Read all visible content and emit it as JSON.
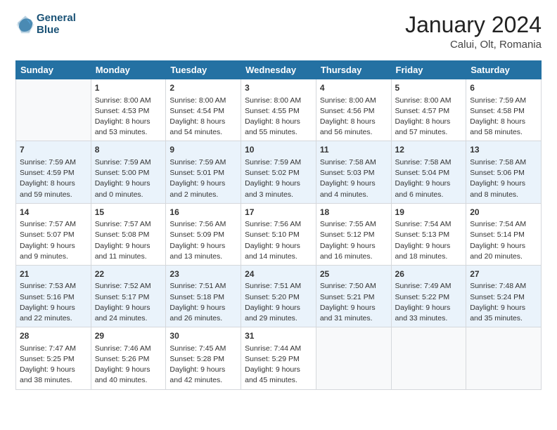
{
  "header": {
    "logo_line1": "General",
    "logo_line2": "Blue",
    "month_title": "January 2024",
    "location": "Calui, Olt, Romania"
  },
  "columns": [
    "Sunday",
    "Monday",
    "Tuesday",
    "Wednesday",
    "Thursday",
    "Friday",
    "Saturday"
  ],
  "weeks": [
    [
      {
        "day": "",
        "info": ""
      },
      {
        "day": "1",
        "info": "Sunrise: 8:00 AM\nSunset: 4:53 PM\nDaylight: 8 hours\nand 53 minutes."
      },
      {
        "day": "2",
        "info": "Sunrise: 8:00 AM\nSunset: 4:54 PM\nDaylight: 8 hours\nand 54 minutes."
      },
      {
        "day": "3",
        "info": "Sunrise: 8:00 AM\nSunset: 4:55 PM\nDaylight: 8 hours\nand 55 minutes."
      },
      {
        "day": "4",
        "info": "Sunrise: 8:00 AM\nSunset: 4:56 PM\nDaylight: 8 hours\nand 56 minutes."
      },
      {
        "day": "5",
        "info": "Sunrise: 8:00 AM\nSunset: 4:57 PM\nDaylight: 8 hours\nand 57 minutes."
      },
      {
        "day": "6",
        "info": "Sunrise: 7:59 AM\nSunset: 4:58 PM\nDaylight: 8 hours\nand 58 minutes."
      }
    ],
    [
      {
        "day": "7",
        "info": "Sunrise: 7:59 AM\nSunset: 4:59 PM\nDaylight: 8 hours\nand 59 minutes."
      },
      {
        "day": "8",
        "info": "Sunrise: 7:59 AM\nSunset: 5:00 PM\nDaylight: 9 hours\nand 0 minutes."
      },
      {
        "day": "9",
        "info": "Sunrise: 7:59 AM\nSunset: 5:01 PM\nDaylight: 9 hours\nand 2 minutes."
      },
      {
        "day": "10",
        "info": "Sunrise: 7:59 AM\nSunset: 5:02 PM\nDaylight: 9 hours\nand 3 minutes."
      },
      {
        "day": "11",
        "info": "Sunrise: 7:58 AM\nSunset: 5:03 PM\nDaylight: 9 hours\nand 4 minutes."
      },
      {
        "day": "12",
        "info": "Sunrise: 7:58 AM\nSunset: 5:04 PM\nDaylight: 9 hours\nand 6 minutes."
      },
      {
        "day": "13",
        "info": "Sunrise: 7:58 AM\nSunset: 5:06 PM\nDaylight: 9 hours\nand 8 minutes."
      }
    ],
    [
      {
        "day": "14",
        "info": "Sunrise: 7:57 AM\nSunset: 5:07 PM\nDaylight: 9 hours\nand 9 minutes."
      },
      {
        "day": "15",
        "info": "Sunrise: 7:57 AM\nSunset: 5:08 PM\nDaylight: 9 hours\nand 11 minutes."
      },
      {
        "day": "16",
        "info": "Sunrise: 7:56 AM\nSunset: 5:09 PM\nDaylight: 9 hours\nand 13 minutes."
      },
      {
        "day": "17",
        "info": "Sunrise: 7:56 AM\nSunset: 5:10 PM\nDaylight: 9 hours\nand 14 minutes."
      },
      {
        "day": "18",
        "info": "Sunrise: 7:55 AM\nSunset: 5:12 PM\nDaylight: 9 hours\nand 16 minutes."
      },
      {
        "day": "19",
        "info": "Sunrise: 7:54 AM\nSunset: 5:13 PM\nDaylight: 9 hours\nand 18 minutes."
      },
      {
        "day": "20",
        "info": "Sunrise: 7:54 AM\nSunset: 5:14 PM\nDaylight: 9 hours\nand 20 minutes."
      }
    ],
    [
      {
        "day": "21",
        "info": "Sunrise: 7:53 AM\nSunset: 5:16 PM\nDaylight: 9 hours\nand 22 minutes."
      },
      {
        "day": "22",
        "info": "Sunrise: 7:52 AM\nSunset: 5:17 PM\nDaylight: 9 hours\nand 24 minutes."
      },
      {
        "day": "23",
        "info": "Sunrise: 7:51 AM\nSunset: 5:18 PM\nDaylight: 9 hours\nand 26 minutes."
      },
      {
        "day": "24",
        "info": "Sunrise: 7:51 AM\nSunset: 5:20 PM\nDaylight: 9 hours\nand 29 minutes."
      },
      {
        "day": "25",
        "info": "Sunrise: 7:50 AM\nSunset: 5:21 PM\nDaylight: 9 hours\nand 31 minutes."
      },
      {
        "day": "26",
        "info": "Sunrise: 7:49 AM\nSunset: 5:22 PM\nDaylight: 9 hours\nand 33 minutes."
      },
      {
        "day": "27",
        "info": "Sunrise: 7:48 AM\nSunset: 5:24 PM\nDaylight: 9 hours\nand 35 minutes."
      }
    ],
    [
      {
        "day": "28",
        "info": "Sunrise: 7:47 AM\nSunset: 5:25 PM\nDaylight: 9 hours\nand 38 minutes."
      },
      {
        "day": "29",
        "info": "Sunrise: 7:46 AM\nSunset: 5:26 PM\nDaylight: 9 hours\nand 40 minutes."
      },
      {
        "day": "30",
        "info": "Sunrise: 7:45 AM\nSunset: 5:28 PM\nDaylight: 9 hours\nand 42 minutes."
      },
      {
        "day": "31",
        "info": "Sunrise: 7:44 AM\nSunset: 5:29 PM\nDaylight: 9 hours\nand 45 minutes."
      },
      {
        "day": "",
        "info": ""
      },
      {
        "day": "",
        "info": ""
      },
      {
        "day": "",
        "info": ""
      }
    ]
  ]
}
